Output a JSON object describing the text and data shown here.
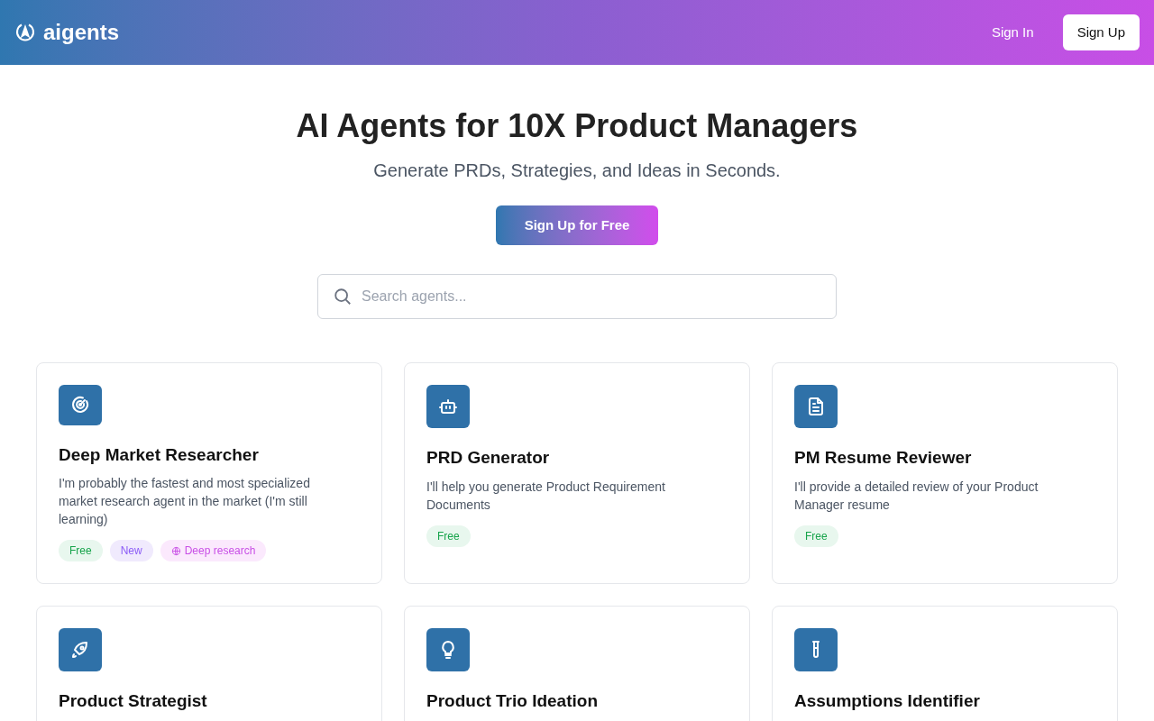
{
  "header": {
    "logo": "aigents",
    "nav": [
      {
        "label": "Sign In",
        "kind": "link"
      },
      {
        "label": "Sign Up",
        "kind": "button"
      }
    ]
  },
  "hero": {
    "title": "AI Agents for 10X Product Managers",
    "subtitle": "Generate PRDs, Strategies, and Ideas in Seconds.",
    "cta": "Sign Up for Free"
  },
  "search": {
    "placeholder": "Search agents..."
  },
  "agents": [
    {
      "name": "Deep Market Researcher",
      "description": "I'm probably the fastest and most specialized market research agent in the market (I'm still learning)",
      "tags": [
        {
          "label": "Free",
          "kind": "free"
        },
        {
          "label": "New",
          "kind": "new"
        },
        {
          "label": "Deep research",
          "kind": "feature"
        }
      ]
    },
    {
      "name": "PRD Generator",
      "description": "I'll help you generate Product Requirement Documents",
      "tags": [
        {
          "label": "Free",
          "kind": "free"
        }
      ]
    },
    {
      "name": "PM Resume Reviewer",
      "description": "I'll provide a detailed review of your Product Manager resume",
      "tags": [
        {
          "label": "Free",
          "kind": "free"
        }
      ]
    },
    {
      "name": "Product Strategist"
    },
    {
      "name": "Product Trio Ideation"
    },
    {
      "name": "Assumptions Identifier"
    }
  ]
}
